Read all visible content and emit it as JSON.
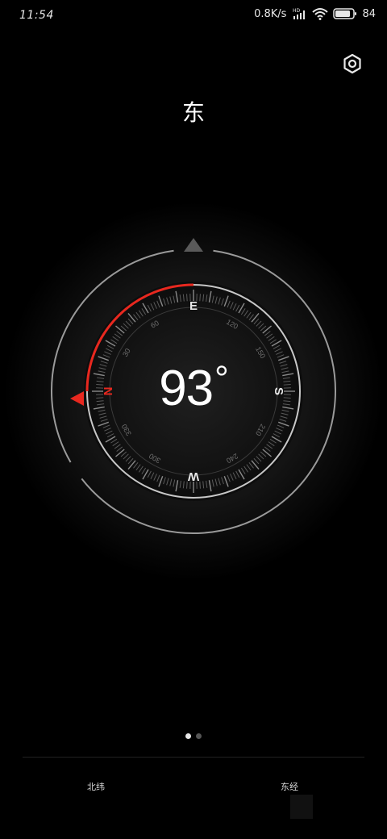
{
  "status_bar": {
    "time": "11:54",
    "network_speed": "0.8K/s",
    "network_type": "HD",
    "battery": "84",
    "icons": [
      "signal-icon",
      "wifi-icon",
      "battery-icon"
    ]
  },
  "header": {
    "settings_icon": "gear-hex-icon",
    "direction": "东"
  },
  "compass": {
    "heading": "93",
    "degree_symbol": "°",
    "cardinals": {
      "north": "N",
      "east": "E",
      "south": "S",
      "west": "W"
    },
    "dial_numbers": [
      "30",
      "60",
      "120",
      "150",
      "210",
      "240",
      "300",
      "330"
    ],
    "accent_color": "#e8281f"
  },
  "pager": {
    "pages": 2,
    "active_index": 0
  },
  "footer": {
    "latitude_label": "北纬",
    "longitude_label": "东经"
  }
}
